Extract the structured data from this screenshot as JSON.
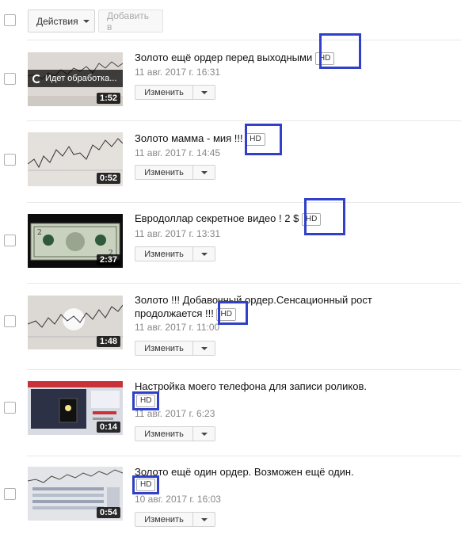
{
  "toolbar": {
    "actions_label": "Действия",
    "add_to_label": "Добавить в"
  },
  "videos": [
    {
      "title": "Золото ещё ордер перед выходными",
      "hd": "HD",
      "date": "11 авг. 2017 г. 16:31",
      "duration": "1:52",
      "processing": "Идет обработка...",
      "edit": "Изменить",
      "thumb": "chart"
    },
    {
      "title": "Золото мамма - мия !!!",
      "hd": "HD",
      "date": "11 авг. 2017 г. 14:45",
      "duration": "0:52",
      "edit": "Изменить",
      "thumb": "chart"
    },
    {
      "title": "Евродоллар секретное видео ! 2 $",
      "hd": "HD",
      "date": "11 авг. 2017 г. 13:31",
      "duration": "2:37",
      "edit": "Изменить",
      "thumb": "dollar"
    },
    {
      "title_line1": "Золото !!! Добавочный ордер.Сенсационный рост",
      "title_line2": "продолжается !!!",
      "hd": "HD",
      "date": "11 авг. 2017 г. 11:00",
      "duration": "1:48",
      "edit": "Изменить",
      "thumb": "chart"
    },
    {
      "title": "Настройка моего телефона для записи роликов.",
      "hd": "HD",
      "date": "11 авг. 2017 г. 6:23",
      "duration": "0:14",
      "edit": "Изменить",
      "thumb": "phone"
    },
    {
      "title": "Золото ещё один ордер. Возможен ещё один.",
      "hd": "HD",
      "date": "10 авг. 2017 г. 16:03",
      "duration": "0:54",
      "edit": "Изменить",
      "thumb": "table"
    }
  ],
  "colors": {
    "highlight": "#3040c8"
  }
}
